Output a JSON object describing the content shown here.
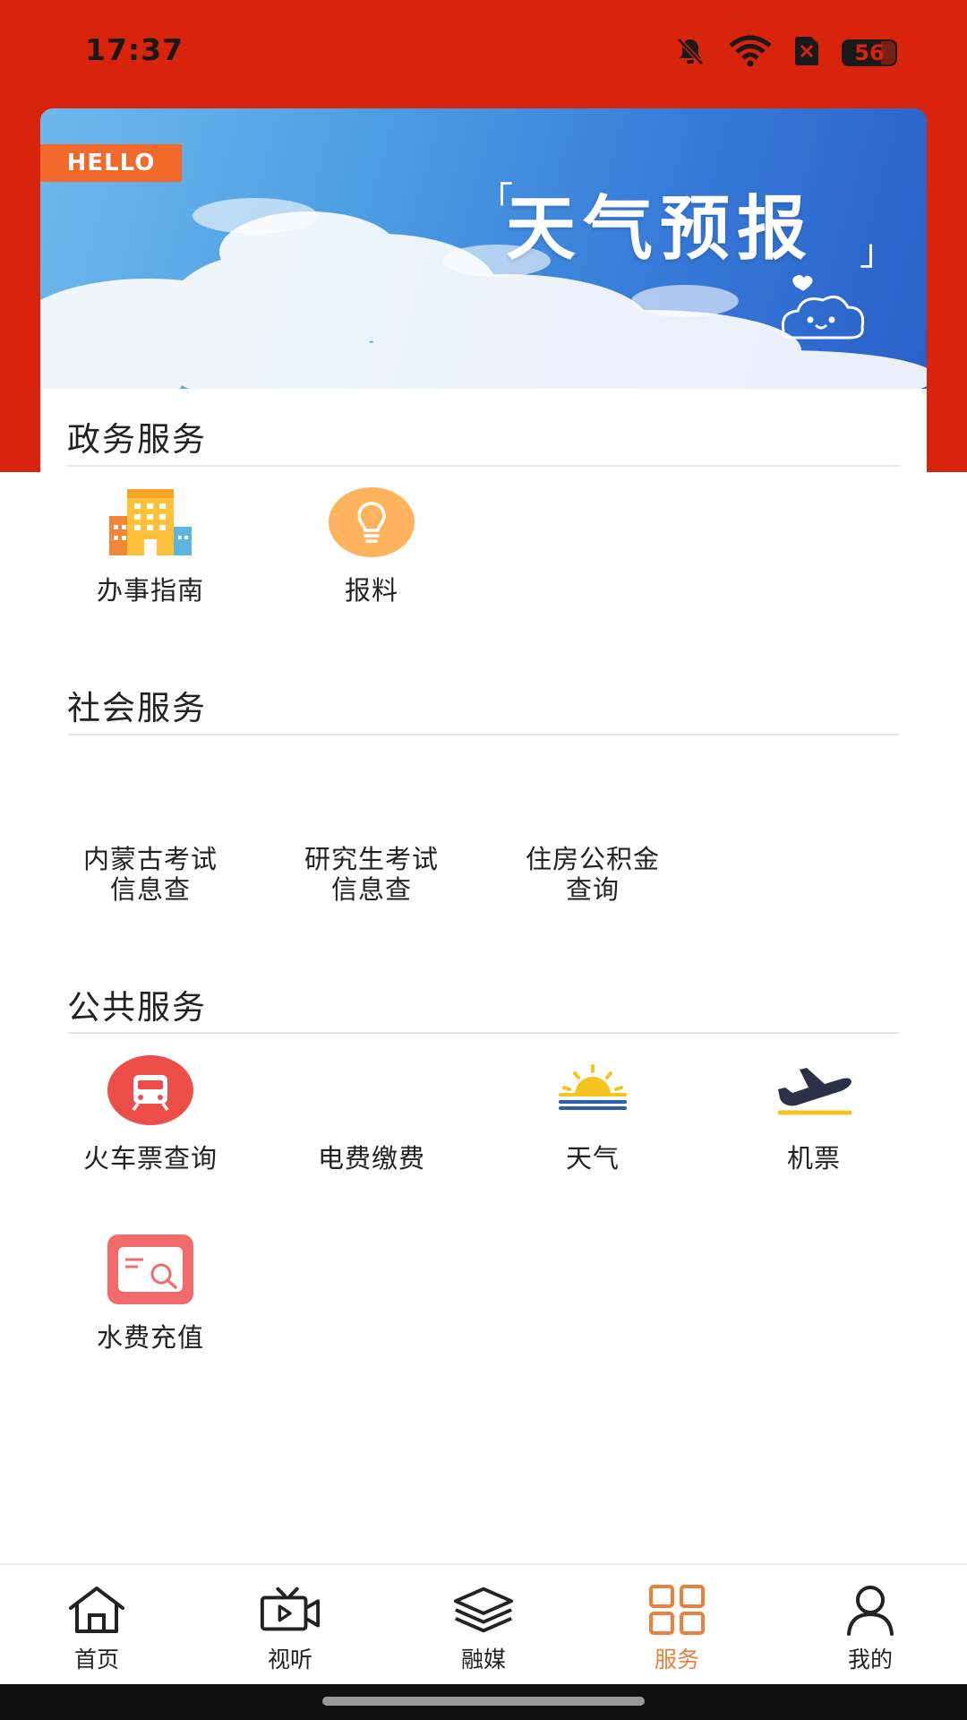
{
  "status_bar": {
    "time": "17:37",
    "battery": "56",
    "icons": [
      "bell-off-icon",
      "wifi-icon",
      "sim-x-icon",
      "battery-icon"
    ]
  },
  "banner": {
    "tag": "HELLO",
    "title": "天气预报"
  },
  "sections": {
    "government": {
      "title": "政务服务",
      "items": [
        {
          "label": "办事指南",
          "icon": "building-icon"
        },
        {
          "label": "报料",
          "icon": "lightbulb-icon"
        }
      ]
    },
    "social": {
      "title": "社会服务",
      "items": [
        {
          "label": "内蒙古考试信息查"
        },
        {
          "label": "研究生考试信息查"
        },
        {
          "label": "住房公积金查询"
        }
      ]
    },
    "public": {
      "title": "公共服务",
      "items": [
        {
          "label": "火车票查询",
          "icon": "train-icon"
        },
        {
          "label": "电费缴费"
        },
        {
          "label": "天气",
          "icon": "sunrise-icon"
        },
        {
          "label": "机票",
          "icon": "airplane-icon"
        },
        {
          "label": "水费充值",
          "icon": "bill-search-icon"
        }
      ]
    }
  },
  "bottom_nav": {
    "items": [
      {
        "label": "首页",
        "icon": "home-icon"
      },
      {
        "label": "视听",
        "icon": "video-icon"
      },
      {
        "label": "融媒",
        "icon": "layers-icon"
      },
      {
        "label": "服务",
        "icon": "grid-icon",
        "active": true
      },
      {
        "label": "我的",
        "icon": "user-icon"
      }
    ]
  },
  "colors": {
    "header_red": "#d8240d",
    "accent_orange": "#e9803f",
    "hello_tag": "#f2692c",
    "train_red": "#ee4e4a",
    "bulb_orange": "#ffb35c"
  }
}
